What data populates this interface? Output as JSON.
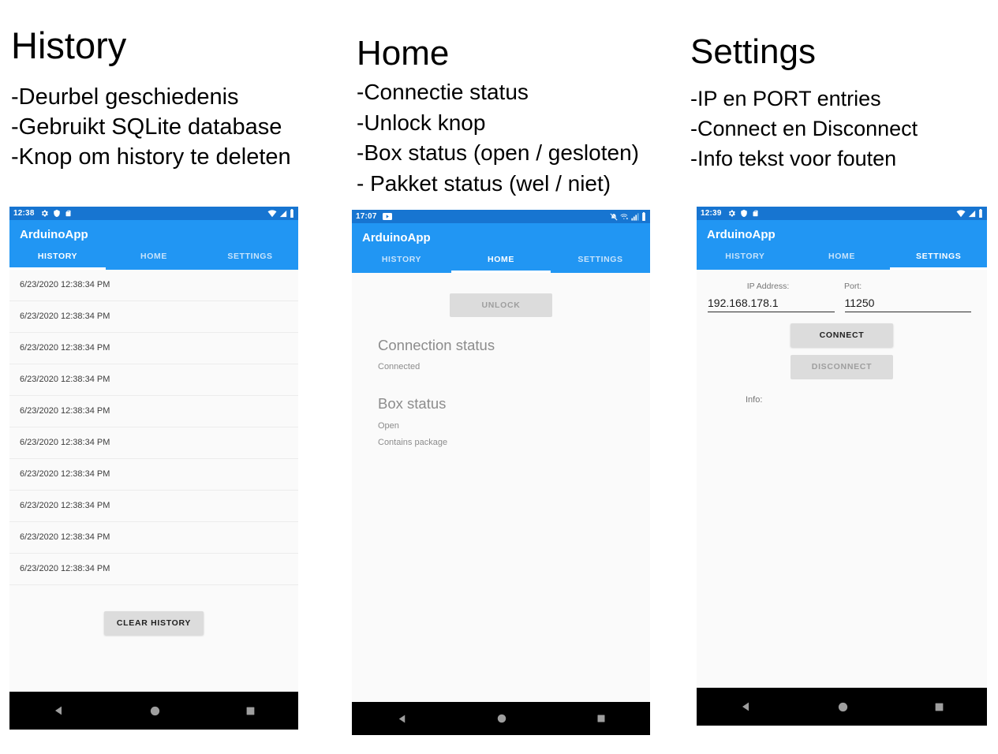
{
  "slide": {
    "panels": [
      {
        "title": "History",
        "bullets": [
          "-Deurbel geschiedenis",
          "-Gebruikt SQLite database",
          "-Knop om history te deleten"
        ]
      },
      {
        "title": "Home",
        "bullets": [
          "-Connectie status",
          "-Unlock knop",
          "-Box status (open / gesloten)",
          "- Pakket status (wel / niet)"
        ]
      },
      {
        "title": "Settings",
        "bullets": [
          "-IP en PORT entries",
          "-Connect en Disconnect",
          "-Info tekst voor fouten"
        ]
      }
    ]
  },
  "colors": {
    "statusbar": "#1775d1",
    "appbar": "#2196f3",
    "tab_active": "#ffffff",
    "tab_inactive": "#c7e3fb",
    "screen_bg": "#fafafa",
    "button_bg": "#dcdcdc",
    "navbar": "#000000",
    "heading_gray": "#8c8c8c"
  },
  "app": {
    "title": "ArduinoApp",
    "tabs": [
      "HISTORY",
      "HOME",
      "SETTINGS"
    ]
  },
  "phone_history": {
    "statusbar": {
      "clock": "12:38",
      "left_icons": [
        "gear-icon",
        "shield-icon",
        "sdcard-icon"
      ],
      "right_icons": [
        "wifi-icon",
        "signal-icon",
        "battery-icon"
      ]
    },
    "active_tab": "HISTORY",
    "entries": [
      "6/23/2020 12:38:34 PM",
      "6/23/2020 12:38:34 PM",
      "6/23/2020 12:38:34 PM",
      "6/23/2020 12:38:34 PM",
      "6/23/2020 12:38:34 PM",
      "6/23/2020 12:38:34 PM",
      "6/23/2020 12:38:34 PM",
      "6/23/2020 12:38:34 PM",
      "6/23/2020 12:38:34 PM",
      "6/23/2020 12:38:34 PM"
    ],
    "clear_button": "CLEAR HISTORY"
  },
  "phone_home": {
    "statusbar": {
      "clock": "17:07",
      "left_icons": [
        "video-icon"
      ],
      "right_icons": [
        "mute-icon",
        "wifi-plus-icon",
        "signal-icon",
        "battery-icon"
      ]
    },
    "active_tab": "HOME",
    "unlock_button": "UNLOCK",
    "connection_heading": "Connection status",
    "connection_value": "Connected",
    "box_heading": "Box status",
    "box_value": "Open",
    "package_value": "Contains package"
  },
  "phone_settings": {
    "statusbar": {
      "clock": "12:39",
      "left_icons": [
        "gear-icon",
        "shield-icon",
        "sdcard-icon"
      ],
      "right_icons": [
        "wifi-icon",
        "signal-icon",
        "battery-icon"
      ]
    },
    "active_tab": "SETTINGS",
    "ip_label": "IP Address:",
    "port_label": "Port:",
    "ip_value": "192.168.178.1",
    "port_value": "11250",
    "connect_button": "CONNECT",
    "disconnect_button": "DISCONNECT",
    "info_label": "Info:"
  },
  "navbar": {
    "back": "back-triangle-icon",
    "home": "home-circle-icon",
    "recents": "recents-square-icon"
  }
}
